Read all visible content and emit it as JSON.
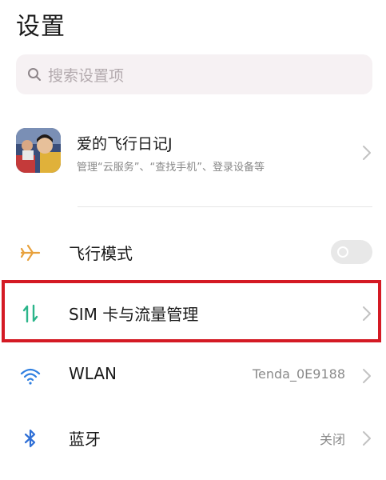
{
  "header": {
    "title": "设置"
  },
  "search": {
    "placeholder": "搜索设置项",
    "icon": "search-icon"
  },
  "account": {
    "name": "爱的飞行日记J",
    "subtitle": "管理“云服务”、“查找手机”、登录设备等",
    "avatar": "avatar-image"
  },
  "settings": {
    "items": [
      {
        "label": "飞行模式",
        "icon": "airplane-icon",
        "type": "toggle",
        "on": false,
        "accent": "#e8a13c"
      },
      {
        "label": "SIM 卡与流量管理",
        "icon": "sim-data-icon",
        "type": "link",
        "highlighted": true,
        "accent": "#2bb58a"
      },
      {
        "label": "WLAN",
        "icon": "wifi-icon",
        "type": "link",
        "value": "Tenda_0E9188",
        "accent": "#2f7fe0"
      },
      {
        "label": "蓝牙",
        "icon": "bluetooth-icon",
        "type": "link",
        "value": "关闭",
        "accent": "#2f6fd6"
      }
    ]
  },
  "colors": {
    "highlight_border": "#d41a24",
    "search_bg": "#f6f1f3"
  }
}
